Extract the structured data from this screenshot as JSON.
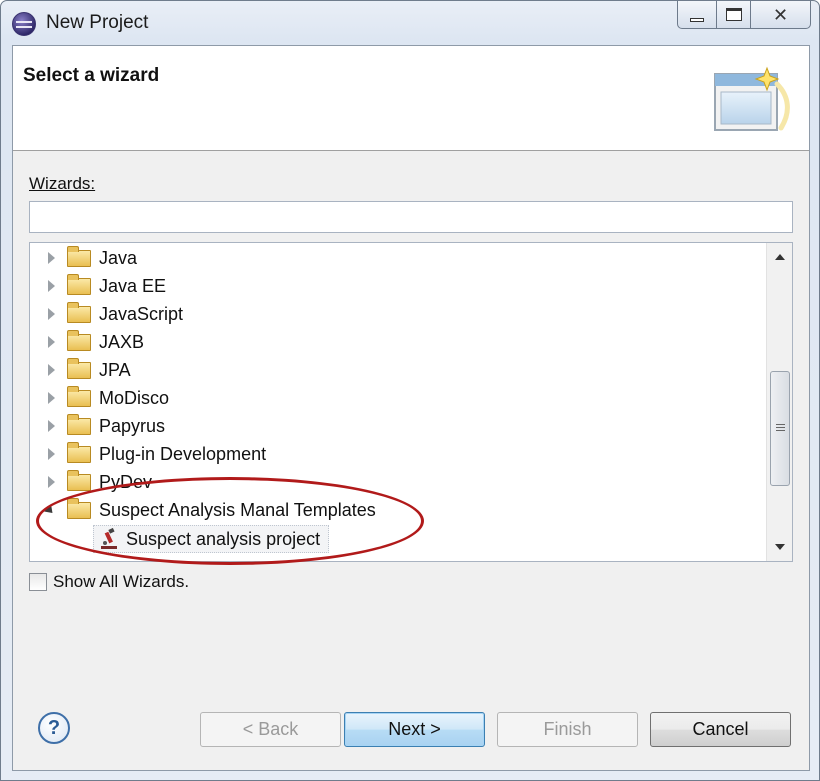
{
  "window": {
    "title": "New Project"
  },
  "banner": {
    "title": "Select a wizard"
  },
  "wizards": {
    "label": "Wizards:",
    "filter_value": "",
    "tree": [
      {
        "label": "Java",
        "expanded": false
      },
      {
        "label": "Java EE",
        "expanded": false
      },
      {
        "label": "JavaScript",
        "expanded": false
      },
      {
        "label": "JAXB",
        "expanded": false
      },
      {
        "label": "JPA",
        "expanded": false
      },
      {
        "label": "MoDisco",
        "expanded": false
      },
      {
        "label": "Papyrus",
        "expanded": false
      },
      {
        "label": "Plug-in Development",
        "expanded": false
      },
      {
        "label": "PyDev",
        "expanded": false
      },
      {
        "label": "Suspect Analysis Manal Templates",
        "expanded": true,
        "children": [
          {
            "label": "Suspect analysis project",
            "selected": true
          }
        ]
      }
    ]
  },
  "show_all": {
    "label": "Show All Wizards.",
    "checked": false
  },
  "buttons": {
    "back": "< Back",
    "next": "Next >",
    "finish": "Finish",
    "cancel": "Cancel"
  },
  "colors": {
    "highlight_ellipse": "#b11a1a",
    "default_button": "#3c7fb1"
  }
}
